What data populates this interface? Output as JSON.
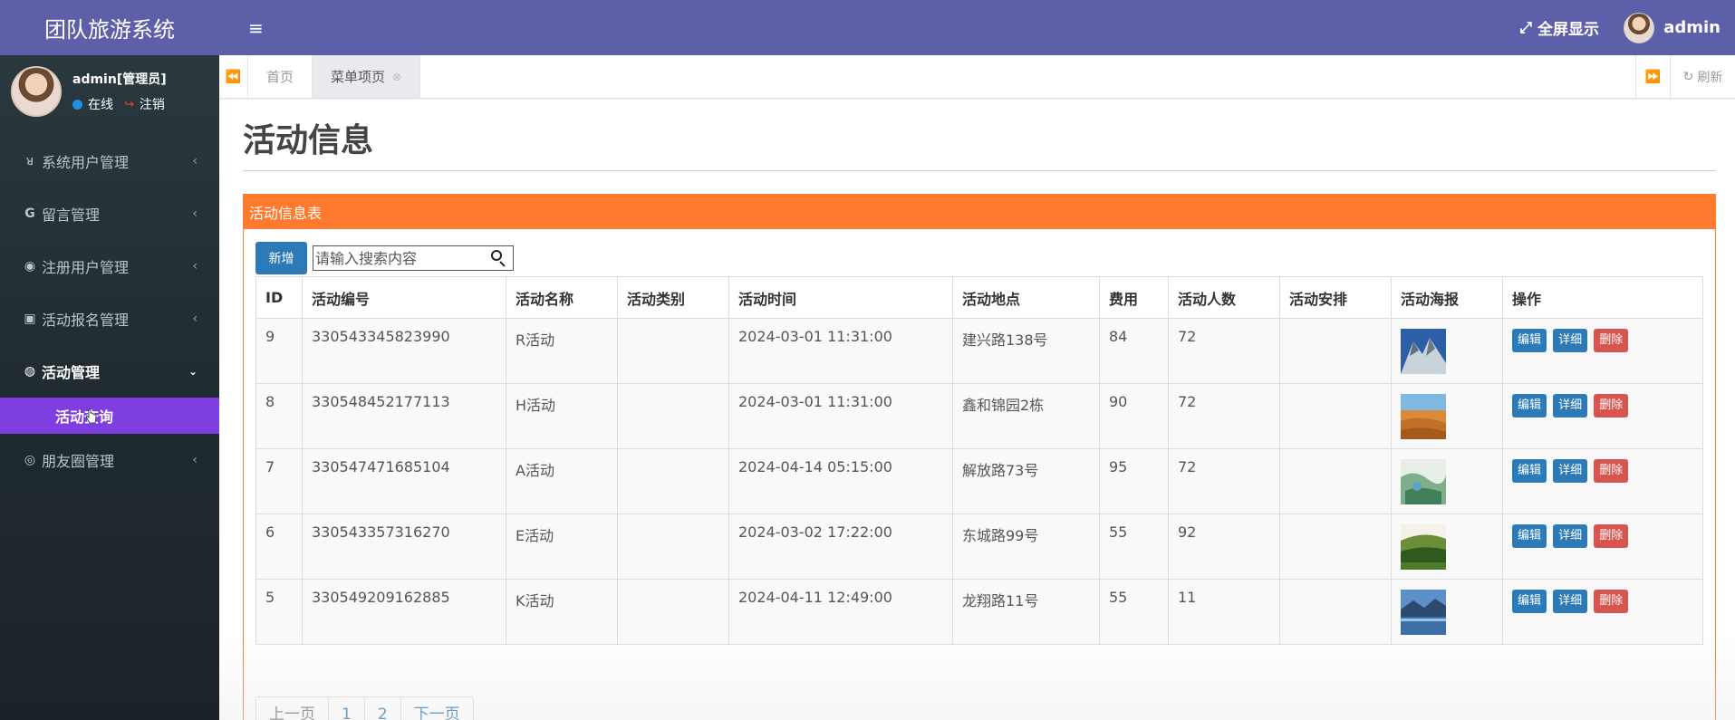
{
  "app": {
    "title": "团队旅游系统"
  },
  "user": {
    "name": "admin[管理员]",
    "status": "在线",
    "logout": "注销",
    "top_name": "admin"
  },
  "topbar": {
    "fullscreen": "全屏显示"
  },
  "menu": {
    "items": [
      {
        "label": "系统用户管理",
        "icon": "user-icon"
      },
      {
        "label": "留言管理",
        "icon": "google-icon"
      },
      {
        "label": "注册用户管理",
        "icon": "reddit-icon"
      },
      {
        "label": "活动报名管理",
        "icon": "image-icon"
      },
      {
        "label": "活动管理",
        "icon": "compass-icon"
      },
      {
        "label": "朋友圈管理",
        "icon": "dribbble-icon"
      }
    ],
    "sub_item": "活动查询"
  },
  "tabs": {
    "items": [
      "首页",
      "菜单项页"
    ],
    "refresh": "刷新"
  },
  "page": {
    "title": "活动信息",
    "panel_title": "活动信息表"
  },
  "toolbar": {
    "add_label": "新增",
    "search_placeholder": "请输入搜索内容"
  },
  "table": {
    "headers": [
      "ID",
      "活动编号",
      "活动名称",
      "活动类别",
      "活动时间",
      "活动地点",
      "费用",
      "活动人数",
      "活动安排",
      "活动海报",
      "操作"
    ],
    "rows": [
      {
        "id": "9",
        "code": "330543345823990",
        "name": "R活动",
        "category": "",
        "time": "2024-03-01 11:31:00",
        "place": "建兴路138号",
        "fee": "84",
        "people": "72",
        "arrangement": ""
      },
      {
        "id": "8",
        "code": "330548452177113",
        "name": "H活动",
        "category": "",
        "time": "2024-03-01 11:31:00",
        "place": "鑫和锦园2栋",
        "fee": "90",
        "people": "72",
        "arrangement": ""
      },
      {
        "id": "7",
        "code": "330547471685104",
        "name": "A活动",
        "category": "",
        "time": "2024-04-14 05:15:00",
        "place": "解放路73号",
        "fee": "95",
        "people": "72",
        "arrangement": ""
      },
      {
        "id": "6",
        "code": "330543357316270",
        "name": "E活动",
        "category": "",
        "time": "2024-03-02 17:22:00",
        "place": "东城路99号",
        "fee": "55",
        "people": "92",
        "arrangement": ""
      },
      {
        "id": "5",
        "code": "330549209162885",
        "name": "K活动",
        "category": "",
        "time": "2024-04-11 12:49:00",
        "place": "龙翔路11号",
        "fee": "55",
        "people": "11",
        "arrangement": ""
      }
    ],
    "actions": {
      "edit": "编辑",
      "detail": "详细",
      "delete": "删除"
    }
  },
  "pager": {
    "prev": "上一页",
    "pages": [
      "1",
      "2"
    ],
    "next": "下一页"
  },
  "colors": {
    "header": "#5d5fa8",
    "panel": "#ff7a2e",
    "active_sub": "#7f3fe0",
    "primary": "#2d7ab8",
    "danger": "#d9534f"
  }
}
